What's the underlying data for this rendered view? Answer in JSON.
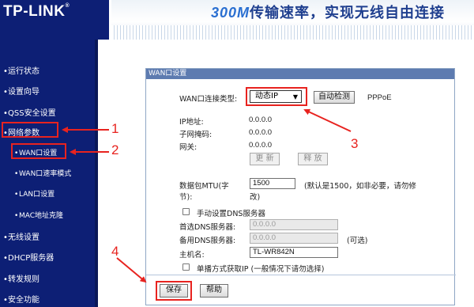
{
  "header": {
    "logo": "TP-LINK",
    "logo_reg": "®",
    "banner_speed": "300M",
    "banner_text": "传输速率，实现无线自由连接"
  },
  "sidebar": {
    "items": [
      {
        "label": "运行状态"
      },
      {
        "label": "设置向导"
      },
      {
        "label": "QSS安全设置"
      },
      {
        "label": "网络参数"
      },
      {
        "label": "WAN口设置"
      },
      {
        "label": "WAN口速率模式"
      },
      {
        "label": "LAN口设置"
      },
      {
        "label": "MAC地址克隆"
      },
      {
        "label": "无线设置"
      },
      {
        "label": "DHCP服务器"
      },
      {
        "label": "转发规则"
      },
      {
        "label": "安全功能"
      }
    ]
  },
  "panel": {
    "title": "WAN口设置",
    "conn_type_label": "WAN口连接类型:",
    "conn_type_value": "动态IP",
    "detect_button": "自动检测",
    "pppoe_text": "PPPoE",
    "ip_label": "IP地址:",
    "ip_value": "0.0.0.0",
    "mask_label": "子网掩码:",
    "mask_value": "0.0.0.0",
    "gateway_label": "网关:",
    "gateway_value": "0.0.0.0",
    "renew_button": "更 新",
    "release_button": "释 放",
    "mtu_label_1": "数据包MTU(字",
    "mtu_label_2": "节):",
    "mtu_value": "1500",
    "mtu_hint_1": "(默认是1500，如非必要，请勿修",
    "mtu_hint_2": "改)",
    "manual_dns_label": "手动设置DNS服务器",
    "primary_dns_label": "首选DNS服务器:",
    "primary_dns_value": "0.0.0.0",
    "secondary_dns_label": "备用DNS服务器:",
    "secondary_dns_value": "0.0.0.0",
    "optional_text": "(可选)",
    "hostname_label": "主机名:",
    "hostname_value": "TL-WR842N",
    "unicast_label": "单播方式获取IP  (一般情况下请勿选择)",
    "save_button": "保存",
    "help_button": "帮助"
  },
  "annotations": [
    "1",
    "2",
    "3",
    "4"
  ],
  "colors": {
    "navy": "#0d1f75",
    "panel_title": "#5d7bb0",
    "annotation_red": "#e8231f"
  }
}
